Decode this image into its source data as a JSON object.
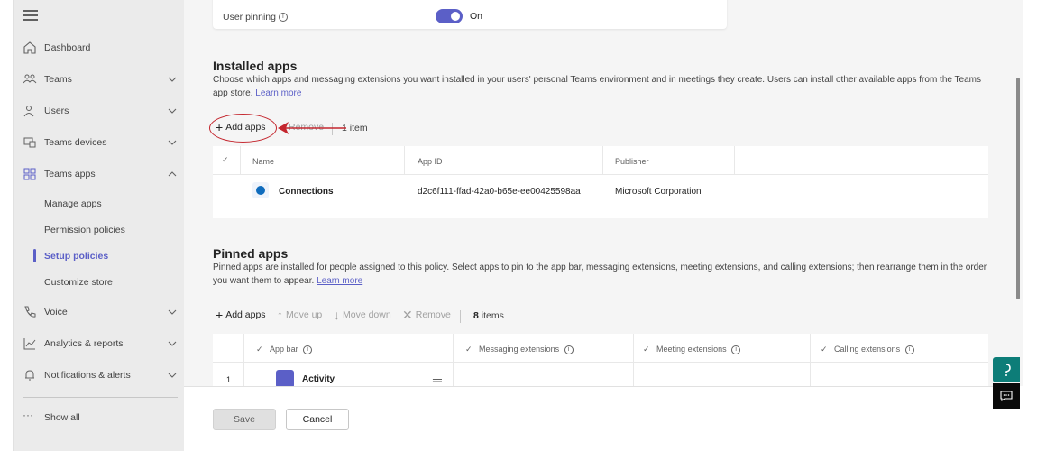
{
  "sidebar": {
    "items": [
      {
        "label": "Dashboard",
        "icon": "home-icon",
        "expandable": false
      },
      {
        "label": "Teams",
        "icon": "teams-icon",
        "expandable": true
      },
      {
        "label": "Users",
        "icon": "users-icon",
        "expandable": true
      },
      {
        "label": "Teams devices",
        "icon": "devices-icon",
        "expandable": true
      },
      {
        "label": "Teams apps",
        "icon": "apps-icon",
        "expandable": true,
        "expanded": true
      },
      {
        "label": "Voice",
        "icon": "phone-icon",
        "expandable": true
      },
      {
        "label": "Analytics & reports",
        "icon": "chart-icon",
        "expandable": true
      },
      {
        "label": "Notifications & alerts",
        "icon": "bell-icon",
        "expandable": true
      }
    ],
    "sub_items": [
      "Manage apps",
      "Permission policies",
      "Setup policies",
      "Customize store"
    ],
    "active_sub_item": "Setup policies",
    "show_all": "Show all"
  },
  "user_pinning": {
    "label": "User pinning",
    "state": "On",
    "enabled": true
  },
  "installed_apps": {
    "title": "Installed apps",
    "description": "Choose which apps and messaging extensions you want installed in your users' personal Teams environment and in meetings they create. Users can install other available apps from the Teams app store.",
    "learn_more": "Learn more",
    "toolbar": {
      "add": "Add apps",
      "remove": "Remove",
      "count": "1 item"
    },
    "columns": [
      "Name",
      "App ID",
      "Publisher"
    ],
    "rows": [
      {
        "name": "Connections",
        "app_id": "d2c6f111-ffad-42a0-b65e-ee00425598aa",
        "publisher": "Microsoft Corporation"
      }
    ]
  },
  "pinned_apps": {
    "title": "Pinned apps",
    "description": "Pinned apps are installed for people assigned to this policy. Select apps to pin to the app bar, messaging extensions, meeting extensions, and calling extensions; then rearrange them in the order you want them to appear.",
    "learn_more": "Learn more",
    "toolbar": {
      "add": "Add apps",
      "move_up": "Move up",
      "move_down": "Move down",
      "remove": "Remove",
      "count_num": "8",
      "count_label": "items"
    },
    "columns": [
      "App bar",
      "Messaging extensions",
      "Meeting extensions",
      "Calling extensions"
    ],
    "rows": [
      {
        "index": "1",
        "name": "Activity"
      }
    ]
  },
  "footer": {
    "save": "Save",
    "cancel": "Cancel"
  },
  "colors": {
    "accent": "#5b5fc7",
    "annotation": "#c4262e"
  }
}
